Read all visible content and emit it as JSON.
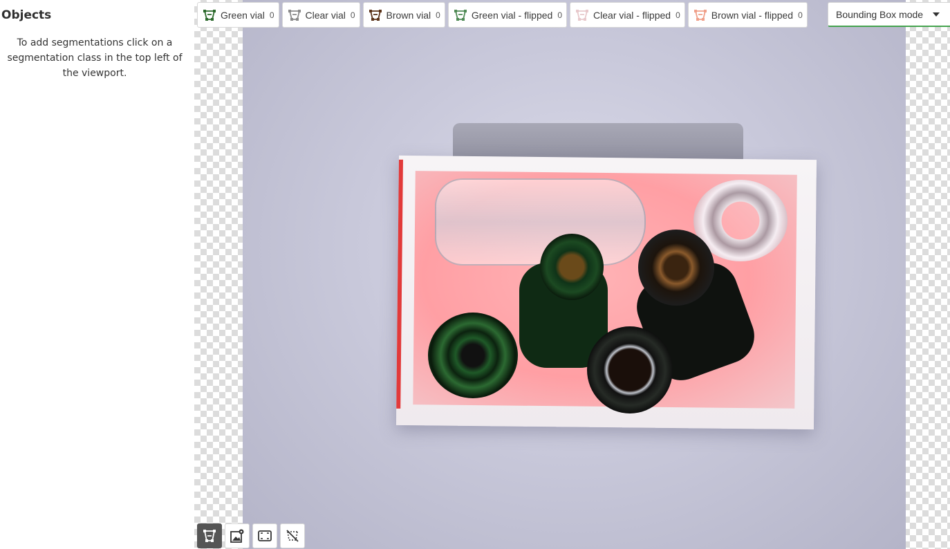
{
  "sidebar": {
    "title": "Objects",
    "hint": "To add segmentations click on a segmentation class in the top left of the viewport."
  },
  "classes": [
    {
      "label": "Green vial",
      "count": "0",
      "color": "#2d6a2d"
    },
    {
      "label": "Clear vial",
      "count": "0",
      "color": "#8a8a8a"
    },
    {
      "label": "Brown vial",
      "count": "0",
      "color": "#5a3218"
    },
    {
      "label": "Green vial - flipped",
      "count": "0",
      "color": "#4f8a55"
    },
    {
      "label": "Clear vial - flipped",
      "count": "0",
      "color": "#e8c9cc"
    },
    {
      "label": "Brown vial - flipped",
      "count": "0",
      "color": "#f0a08a"
    }
  ],
  "mode": {
    "selected": "Bounding Box mode"
  },
  "bottom_tools": [
    {
      "icon": "bounding-box-icon",
      "active": true
    },
    {
      "icon": "image-settings-icon",
      "active": false
    },
    {
      "icon": "fit-viewport-icon",
      "active": false
    },
    {
      "icon": "hide-annotations-icon",
      "active": false
    }
  ],
  "colors": {
    "accent_green": "#44a34e",
    "active_tool_bg": "#555555"
  }
}
